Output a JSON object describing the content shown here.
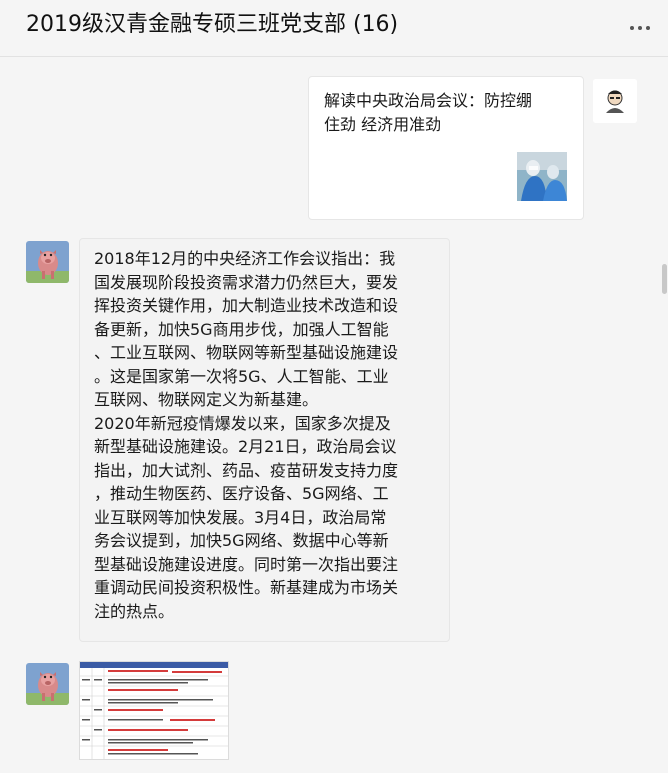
{
  "header": {
    "title": "2019级汉青金融专硕三班党支部 (16)",
    "more_icon": "more-dots-icon"
  },
  "messages": [
    {
      "sender": "self",
      "type": "link-card",
      "title": "解读中央政治局会议：防控绷住劲 经济用准劲",
      "thumbnail_icon": "medical-workers-photo"
    },
    {
      "sender": "other",
      "type": "text",
      "text": "2018年12月的中央经济工作会议指出：我\n国发展现阶段投资需求潜力仍然巨大，要发\n挥投资关键作用，加大制造业技术改造和设\n备更新，加快5G商用步伐，加强人工智能\n、工业互联网、物联网等新型基础设施建设\n。这是国家第一次将5G、人工智能、工业\n互联网、物联网定义为新基建。\n2020年新冠疫情爆发以来，国家多次提及\n新型基础设施建设。2月21日，政治局会议\n指出，加大试剂、药品、疫苗研发支持力度\n，推动生物医药、医疗设备、5G网络、工\n业互联网等加快发展。3月4日，政治局常\n务会议提到，加快5G网络、数据中心等新\n型基础设施建设进度。同时第一次指出要注\n重调动民间投资积极性。新基建成为市场关\n注的热点。"
    },
    {
      "sender": "other",
      "type": "image",
      "image_icon": "spreadsheet-screenshot-thumbnail"
    }
  ],
  "colors": {
    "background": "#f5f5f5",
    "bubble_white": "#ffffff",
    "bubble_gray": "#f3f3f3",
    "text": "#1a1a1a"
  }
}
